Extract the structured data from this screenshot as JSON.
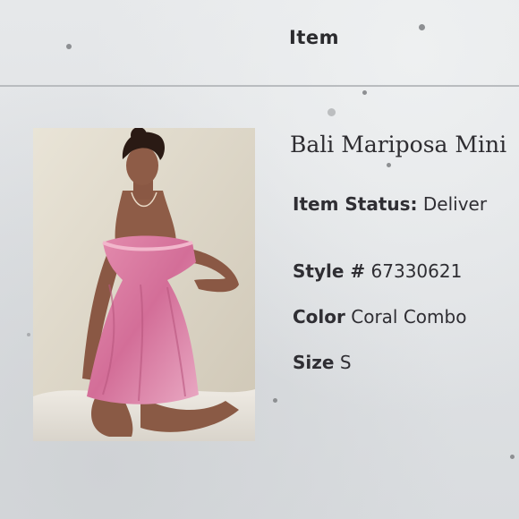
{
  "table": {
    "column_header": "Item"
  },
  "item": {
    "name": "Bali Mariposa Mini",
    "status_label": "Item Status:",
    "status_value": "Deliver",
    "style_label": "Style #",
    "style_value": "67330621",
    "color_label": "Color",
    "color_value": "Coral Combo",
    "size_label": "Size",
    "size_value": "S",
    "photo_icon": "product-photo"
  },
  "colors": {
    "background": "#dfe1e3",
    "text": "#2f2e33",
    "divider": "#b9bcbf"
  }
}
